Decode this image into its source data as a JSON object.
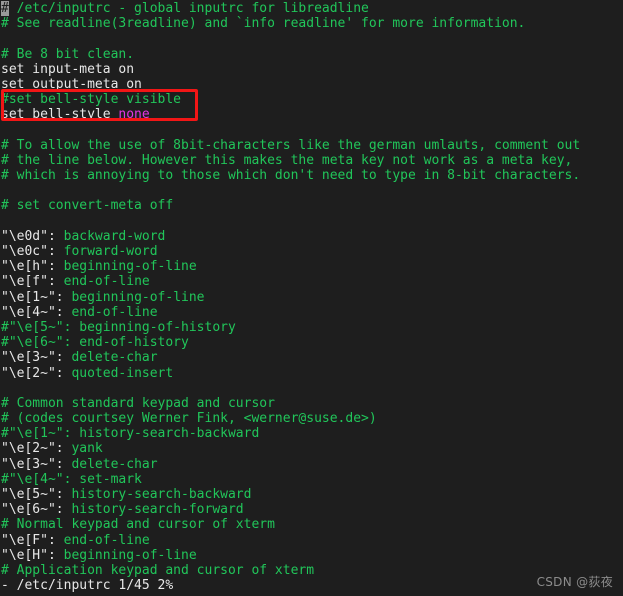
{
  "terminal": {
    "background_color": "#1e1e1e",
    "comment_color": "#21c65a",
    "text_color": "#e8e8e8",
    "value_color": "#e335e3",
    "cursor_color": "#9a9a9a",
    "annotation_color": "#f21616",
    "file_name": "/etc/inputrc",
    "lines": [
      {
        "id": 0,
        "segments": [
          {
            "text": "#",
            "style": "cursor"
          },
          {
            "text": " /etc/inputrc - global inputrc for libreadline",
            "style": "green"
          }
        ]
      },
      {
        "id": 1,
        "segments": [
          {
            "text": "# See readline(3readline) and `info readline' for more information.",
            "style": "green"
          }
        ]
      },
      {
        "id": 2,
        "segments": [
          {
            "text": "",
            "style": "green"
          }
        ]
      },
      {
        "id": 3,
        "segments": [
          {
            "text": "# Be 8 bit clean.",
            "style": "green"
          }
        ]
      },
      {
        "id": 4,
        "segments": [
          {
            "text": "set input-meta on",
            "style": "white"
          }
        ]
      },
      {
        "id": 5,
        "segments": [
          {
            "text": "set output-meta on",
            "style": "white"
          }
        ]
      },
      {
        "id": 6,
        "segments": [
          {
            "text": "#set bell-style visible",
            "style": "green"
          }
        ]
      },
      {
        "id": 7,
        "segments": [
          {
            "text": "set bell-style ",
            "style": "white"
          },
          {
            "text": "none",
            "style": "magenta"
          }
        ]
      },
      {
        "id": 8,
        "segments": [
          {
            "text": "",
            "style": "green"
          }
        ]
      },
      {
        "id": 9,
        "segments": [
          {
            "text": "# To allow the use of 8bit-characters like the german umlauts, comment out",
            "style": "green"
          }
        ]
      },
      {
        "id": 10,
        "segments": [
          {
            "text": "# the line below. However this makes the meta key not work as a meta key,",
            "style": "green"
          }
        ]
      },
      {
        "id": 11,
        "segments": [
          {
            "text": "# which is annoying to those which don't need to type in 8-bit characters.",
            "style": "green"
          }
        ]
      },
      {
        "id": 12,
        "segments": [
          {
            "text": "",
            "style": "green"
          }
        ]
      },
      {
        "id": 13,
        "segments": [
          {
            "text": "# set convert-meta off",
            "style": "green"
          }
        ]
      },
      {
        "id": 14,
        "segments": [
          {
            "text": "",
            "style": "green"
          }
        ]
      },
      {
        "id": 15,
        "segments": [
          {
            "text": "\"\\e0d\":",
            "style": "white"
          },
          {
            "text": " backward-word",
            "style": "green"
          }
        ]
      },
      {
        "id": 16,
        "segments": [
          {
            "text": "\"\\e0c\":",
            "style": "white"
          },
          {
            "text": " forward-word",
            "style": "green"
          }
        ]
      },
      {
        "id": 17,
        "segments": [
          {
            "text": "\"\\e[h\":",
            "style": "white"
          },
          {
            "text": " beginning-of-line",
            "style": "green"
          }
        ]
      },
      {
        "id": 18,
        "segments": [
          {
            "text": "\"\\e[f\":",
            "style": "white"
          },
          {
            "text": " end-of-line",
            "style": "green"
          }
        ]
      },
      {
        "id": 19,
        "segments": [
          {
            "text": "\"\\e[1~\":",
            "style": "white"
          },
          {
            "text": " beginning-of-line",
            "style": "green"
          }
        ]
      },
      {
        "id": 20,
        "segments": [
          {
            "text": "\"\\e[4~\":",
            "style": "white"
          },
          {
            "text": " end-of-line",
            "style": "green"
          }
        ]
      },
      {
        "id": 21,
        "segments": [
          {
            "text": "#\"\\e[5~\": beginning-of-history",
            "style": "green"
          }
        ]
      },
      {
        "id": 22,
        "segments": [
          {
            "text": "#\"\\e[6~\": end-of-history",
            "style": "green"
          }
        ]
      },
      {
        "id": 23,
        "segments": [
          {
            "text": "\"\\e[3~\":",
            "style": "white"
          },
          {
            "text": " delete-char",
            "style": "green"
          }
        ]
      },
      {
        "id": 24,
        "segments": [
          {
            "text": "\"\\e[2~\":",
            "style": "white"
          },
          {
            "text": " quoted-insert",
            "style": "green"
          }
        ]
      },
      {
        "id": 25,
        "segments": [
          {
            "text": "",
            "style": "green"
          }
        ]
      },
      {
        "id": 26,
        "segments": [
          {
            "text": "# Common standard keypad and cursor",
            "style": "green"
          }
        ]
      },
      {
        "id": 27,
        "segments": [
          {
            "text": "# (codes courtsey Werner Fink, <werner@suse.de>)",
            "style": "green"
          }
        ]
      },
      {
        "id": 28,
        "segments": [
          {
            "text": "#\"\\e[1~\": history-search-backward",
            "style": "green"
          }
        ]
      },
      {
        "id": 29,
        "segments": [
          {
            "text": "\"\\e[2~\":",
            "style": "white"
          },
          {
            "text": " yank",
            "style": "green"
          }
        ]
      },
      {
        "id": 30,
        "segments": [
          {
            "text": "\"\\e[3~\":",
            "style": "white"
          },
          {
            "text": " delete-char",
            "style": "green"
          }
        ]
      },
      {
        "id": 31,
        "segments": [
          {
            "text": "#\"\\e[4~\": set-mark",
            "style": "green"
          }
        ]
      },
      {
        "id": 32,
        "segments": [
          {
            "text": "\"\\e[5~\":",
            "style": "white"
          },
          {
            "text": " history-search-backward",
            "style": "green"
          }
        ]
      },
      {
        "id": 33,
        "segments": [
          {
            "text": "\"\\e[6~\":",
            "style": "white"
          },
          {
            "text": " history-search-forward",
            "style": "green"
          }
        ]
      },
      {
        "id": 34,
        "segments": [
          {
            "text": "# Normal keypad and cursor of xterm",
            "style": "green"
          }
        ]
      },
      {
        "id": 35,
        "segments": [
          {
            "text": "\"\\e[F\":",
            "style": "white"
          },
          {
            "text": " end-of-line",
            "style": "green"
          }
        ]
      },
      {
        "id": 36,
        "segments": [
          {
            "text": "\"\\e[H\":",
            "style": "white"
          },
          {
            "text": " beginning-of-line",
            "style": "green"
          }
        ]
      },
      {
        "id": 37,
        "segments": [
          {
            "text": "# Application keypad and cursor of xterm",
            "style": "green"
          }
        ]
      },
      {
        "id": 38,
        "segments": [
          {
            "text": "- /etc/inputrc 1/45 2%",
            "style": "white"
          }
        ]
      }
    ]
  },
  "annotation": {
    "label": "bell-style-highlight"
  },
  "watermark": {
    "text": "CSDN @荻夜"
  }
}
